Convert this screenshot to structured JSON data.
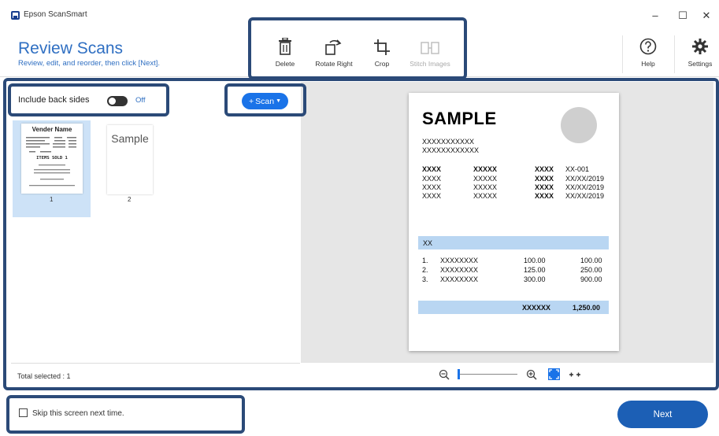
{
  "app": {
    "title": "Epson ScanSmart"
  },
  "window_controls": {
    "minimize": "–",
    "maximize": "☐",
    "close": "✕"
  },
  "header": {
    "title": "Review Scans",
    "subtitle": "Review, edit, and reorder, then click [Next]."
  },
  "toolbar": {
    "delete": "Delete",
    "rotate_right": "Rotate Right",
    "crop": "Crop",
    "stitch_images": "Stitch Images",
    "help": "Help",
    "settings": "Settings"
  },
  "left_panel": {
    "include_back_sides": "Include back sides",
    "toggle_state": "Off",
    "scan_button": "Scan",
    "total_selected": "Total selected : 1"
  },
  "thumbnails": [
    {
      "number": "1",
      "header": "Vender Name",
      "text": "ITEMS SOLD 1",
      "selected": true
    },
    {
      "number": "2",
      "text": "Sample",
      "selected": false
    }
  ],
  "preview_doc": {
    "title": "SAMPLE",
    "lines": [
      "XXXXXXXXXXX",
      "XXXXXXXXXXXX"
    ],
    "info_rows": [
      [
        "XXXX",
        "XXXXX",
        "XXXX",
        "XX-001"
      ],
      [
        "XXXX",
        "XXXXX",
        "XXXX",
        "XX/XX/2019"
      ],
      [
        "XXXX",
        "XXXXX",
        "XXXX",
        "XX/XX/2019"
      ],
      [
        "XXXX",
        "XXXXX",
        "XXXX",
        "XX/XX/2019"
      ]
    ],
    "band_label": "XX",
    "items": [
      [
        "1.",
        "XXXXXXXX",
        "100.00",
        "100.00"
      ],
      [
        "2.",
        "XXXXXXXX",
        "125.00",
        "250.00"
      ],
      [
        "3.",
        "XXXXXXXX",
        "300.00",
        "900.00"
      ]
    ],
    "total_label": "XXXXXX",
    "total_value": "1,250.00"
  },
  "bottom": {
    "skip_label": "Skip this screen next time.",
    "next_button": "Next"
  },
  "colors": {
    "accent": "#2f6fc2",
    "next_button": "#1c5fb5",
    "scan_button": "#1a73e8",
    "highlight_border": "#2b4a78",
    "thumb_selected": "#cde2f7",
    "doc_band": "#b9d6f2"
  }
}
